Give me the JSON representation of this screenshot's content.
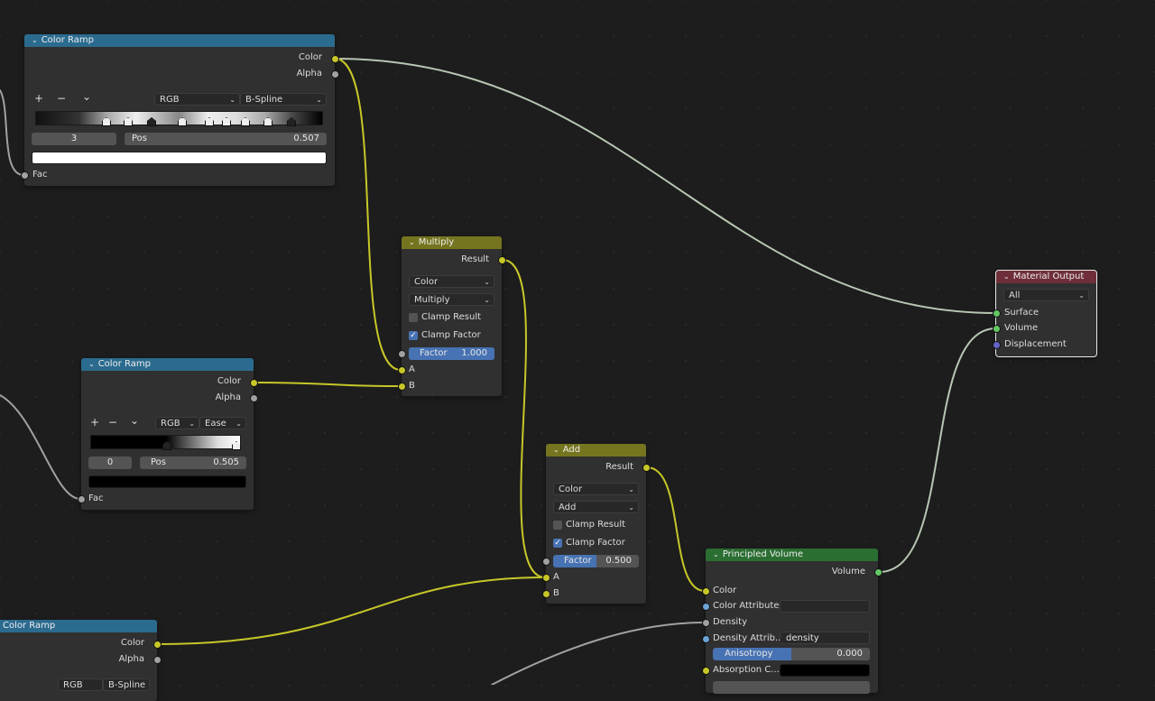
{
  "colors": {
    "converter_header": "#2b6b8f",
    "math_header": "#75751f",
    "shader_header": "#2b6e32",
    "output_header": "#6e2e3a",
    "socket_color": "#c7c729",
    "socket_float": "#a1a1a1",
    "socket_shader": "#63c763",
    "socket_vector": "#6363c7",
    "socket_string": "#6ba3d8",
    "accent": "#4772b3"
  },
  "color_ramp_1": {
    "title": "Color Ramp",
    "out_color": "Color",
    "out_alpha": "Alpha",
    "tool_add": "+",
    "tool_remove": "−",
    "tool_menu": "⌄",
    "color_mode": "RGB",
    "interpolation": "B-Spline",
    "active_index": "3",
    "pos_label": "Pos",
    "pos_value": "0.507",
    "stop_color": "#ffffff",
    "in_fac": "Fac"
  },
  "color_ramp_2": {
    "title": "Color Ramp",
    "out_color": "Color",
    "out_alpha": "Alpha",
    "tool_add": "+",
    "tool_remove": "−",
    "tool_menu": "⌄",
    "color_mode": "RGB",
    "interpolation": "Ease",
    "active_index": "0",
    "pos_label": "Pos",
    "pos_value": "0.505",
    "stop_color": "#000000",
    "in_fac": "Fac"
  },
  "color_ramp_3": {
    "title": "Color Ramp",
    "out_color": "Color",
    "out_alpha": "Alpha",
    "color_mode": "RGB",
    "interpolation": "B-Spline"
  },
  "multiply": {
    "title": "Multiply",
    "out_result": "Result",
    "data_type": "Color",
    "blend_type": "Multiply",
    "clamp_result": "Clamp Result",
    "clamp_result_checked": false,
    "clamp_factor": "Clamp Factor",
    "clamp_factor_checked": true,
    "factor_label": "Factor",
    "factor_value": "1.000",
    "factor_fraction": 1.0,
    "in_a": "A",
    "in_b": "B"
  },
  "add": {
    "title": "Add",
    "out_result": "Result",
    "data_type": "Color",
    "blend_type": "Add",
    "clamp_result": "Clamp Result",
    "clamp_result_checked": false,
    "clamp_factor": "Clamp Factor",
    "clamp_factor_checked": true,
    "factor_label": "Factor",
    "factor_value": "0.500",
    "factor_fraction": 0.5,
    "in_a": "A",
    "in_b": "B"
  },
  "material_output": {
    "title": "Material Output",
    "target": "All",
    "in_surface": "Surface",
    "in_volume": "Volume",
    "in_displacement": "Displacement"
  },
  "principled_volume": {
    "title": "Principled Volume",
    "out_volume": "Volume",
    "in_color": "Color",
    "in_color_attribute": "Color Attribute",
    "in_density": "Density",
    "in_density_attribute": "Density Attrib...",
    "density_attribute_value": "density",
    "anisotropy_label": "Anisotropy",
    "anisotropy_value": "0.000",
    "anisotropy_fraction": 0.5,
    "in_absorption_color": "Absorption C...",
    "absorption_color": "#000000"
  }
}
